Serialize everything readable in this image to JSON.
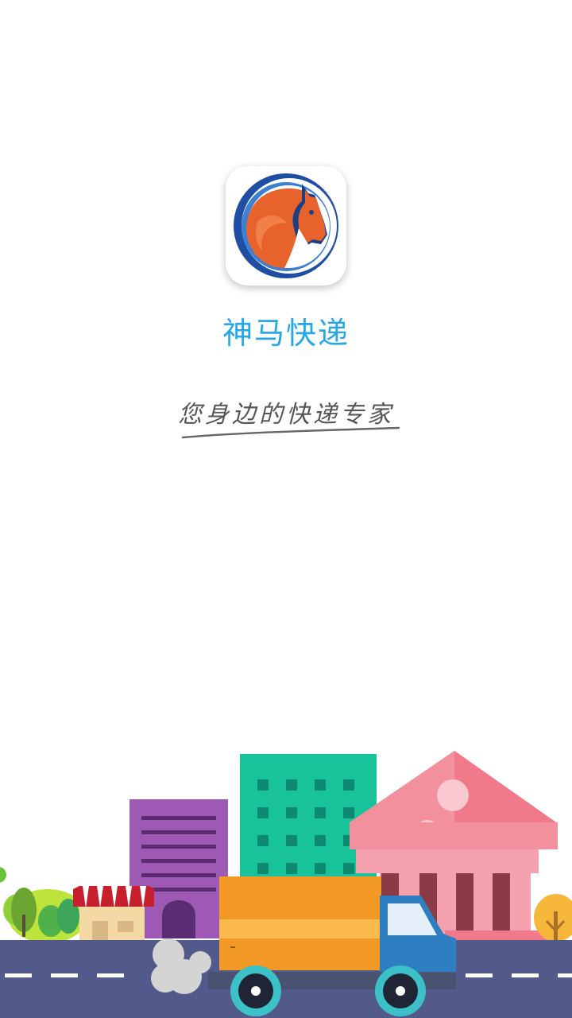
{
  "app": {
    "name": "神马快递",
    "slogan": "您身边的快递专家"
  },
  "icons": {
    "logo": "horse-head-logo",
    "illustration": "city-delivery-truck-illustration"
  },
  "colors": {
    "brand_blue": "#27a8e6",
    "logo_orange": "#e8632b",
    "logo_ring": "#1e4fa3",
    "road": "#515a8a",
    "building_green": "#19c39a",
    "building_purple": "#9d59b4",
    "building_pink": "#f3909e",
    "truck_orange": "#f29a25",
    "truck_blue": "#2d7fc1"
  }
}
